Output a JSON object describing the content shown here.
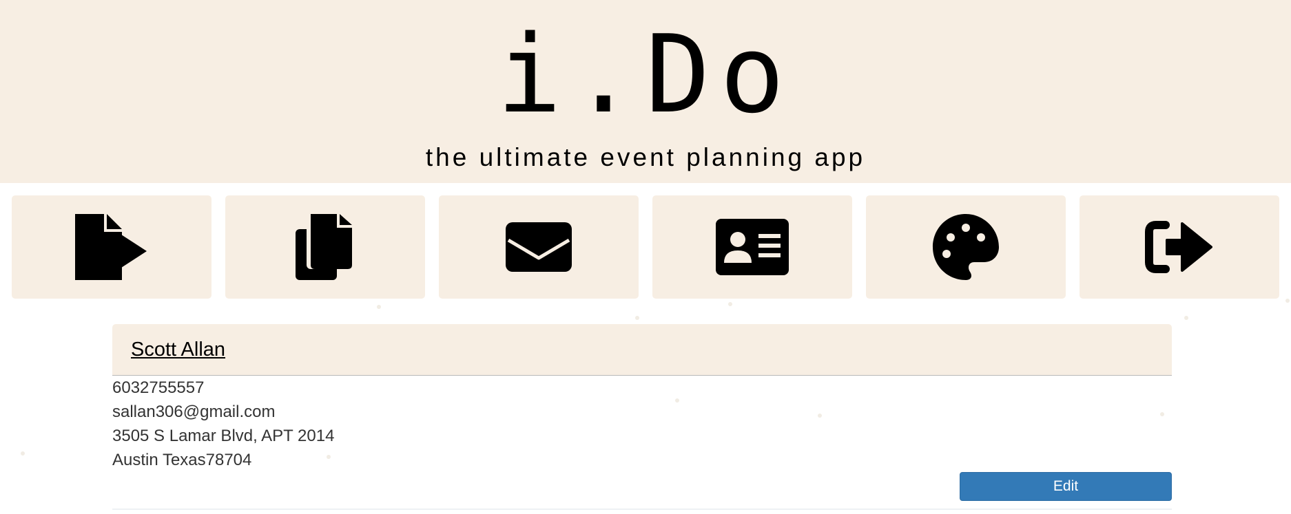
{
  "app": {
    "logo_text": "i.Do",
    "tagline": "the ultimate event planning app"
  },
  "nav": {
    "items": [
      {
        "icon": "file-export-icon",
        "name": "nav-export"
      },
      {
        "icon": "copy-icon",
        "name": "nav-documents"
      },
      {
        "icon": "envelope-icon",
        "name": "nav-mail"
      },
      {
        "icon": "id-card-icon",
        "name": "nav-contact-card"
      },
      {
        "icon": "palette-icon",
        "name": "nav-theme"
      },
      {
        "icon": "sign-out-icon",
        "name": "nav-sign-out"
      }
    ]
  },
  "contact": {
    "name": "Scott Allan",
    "phone": "6032755557",
    "email": "sallan306@gmail.com",
    "address": "3505 S Lamar Blvd, APT 2014",
    "city_line": "Austin Texas78704",
    "edit_label": "Edit"
  },
  "colors": {
    "header_bg": "#f7eee3",
    "button_primary": "#337ab7",
    "text": "#333333"
  }
}
